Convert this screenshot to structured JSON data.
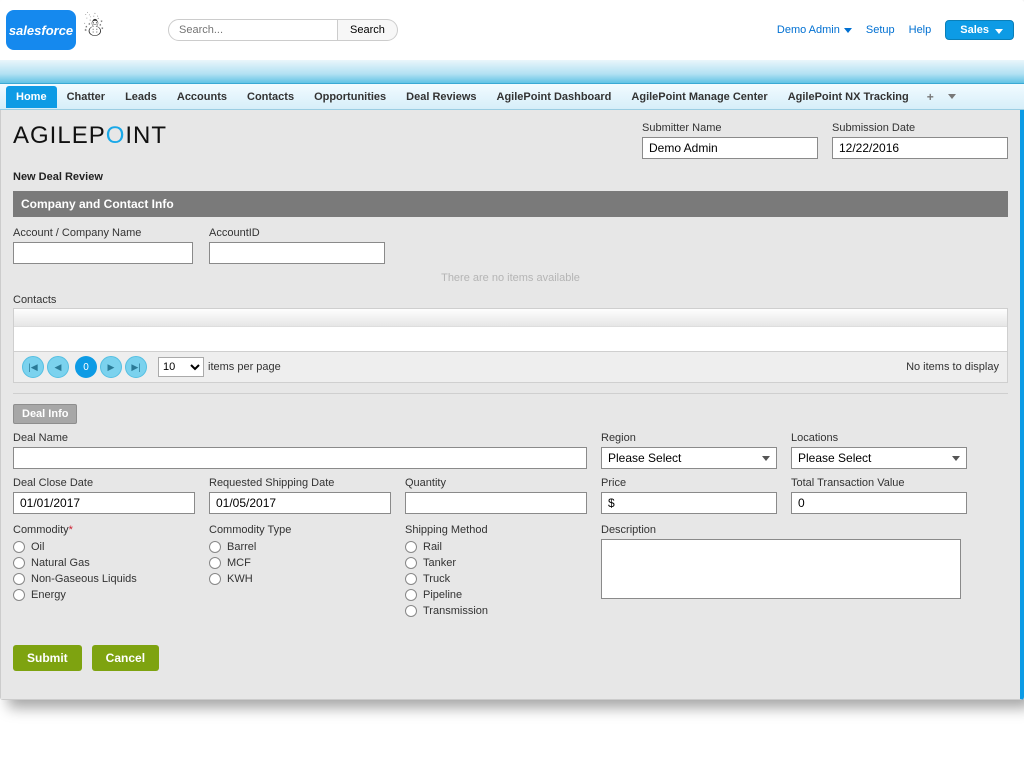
{
  "header": {
    "logo_text": "salesforce",
    "search_placeholder": "Search...",
    "search_btn": "Search",
    "demo_admin": "Demo Admin",
    "setup": "Setup",
    "help": "Help",
    "app_menu": "Sales"
  },
  "tabs": [
    "Home",
    "Chatter",
    "Leads",
    "Accounts",
    "Contacts",
    "Opportunities",
    "Deal Reviews",
    "AgilePoint Dashboard",
    "AgilePoint Manage Center",
    "AgilePoint NX Tracking"
  ],
  "page": {
    "agile_logo_pre": "AGILEP",
    "agile_logo_o": "O",
    "agile_logo_post": "INT",
    "submitter_label": "Submitter Name",
    "submitter_value": "Demo Admin",
    "subdate_label": "Submission Date",
    "subdate_value": "12/22/2016",
    "subtitle": "New Deal Review"
  },
  "section1": {
    "title": "Company and Contact Info",
    "acct_label": "Account / Company Name",
    "acctid_label": "AccountID",
    "empty_msg": "There are no items available",
    "contacts_label": "Contacts"
  },
  "pager": {
    "page_num": "0",
    "per_page": "10",
    "per_page_label": "items per page",
    "no_items": "No items to display"
  },
  "section2": {
    "title": "Deal Info",
    "deal_name_label": "Deal Name",
    "region_label": "Region",
    "region_value": "Please Select",
    "locations_label": "Locations",
    "locations_value": "Please Select",
    "close_label": "Deal Close Date",
    "close_value": "01/01/2017",
    "ship_label": "Requested Shipping Date",
    "ship_value": "01/05/2017",
    "qty_label": "Quantity",
    "price_label": "Price",
    "price_value": "$",
    "ttv_label": "Total Transaction Value",
    "ttv_value": "0",
    "commodity_label": "Commodity",
    "commodity_items": [
      "Oil",
      "Natural Gas",
      "Non-Gaseous Liquids",
      "Energy"
    ],
    "ctype_label": "Commodity Type",
    "ctype_items": [
      "Barrel",
      "MCF",
      "KWH"
    ],
    "smethod_label": "Shipping Method",
    "smethod_items": [
      "Rail",
      "Tanker",
      "Truck",
      "Pipeline",
      "Transmission"
    ],
    "desc_label": "Description"
  },
  "buttons": {
    "submit": "Submit",
    "cancel": "Cancel"
  }
}
